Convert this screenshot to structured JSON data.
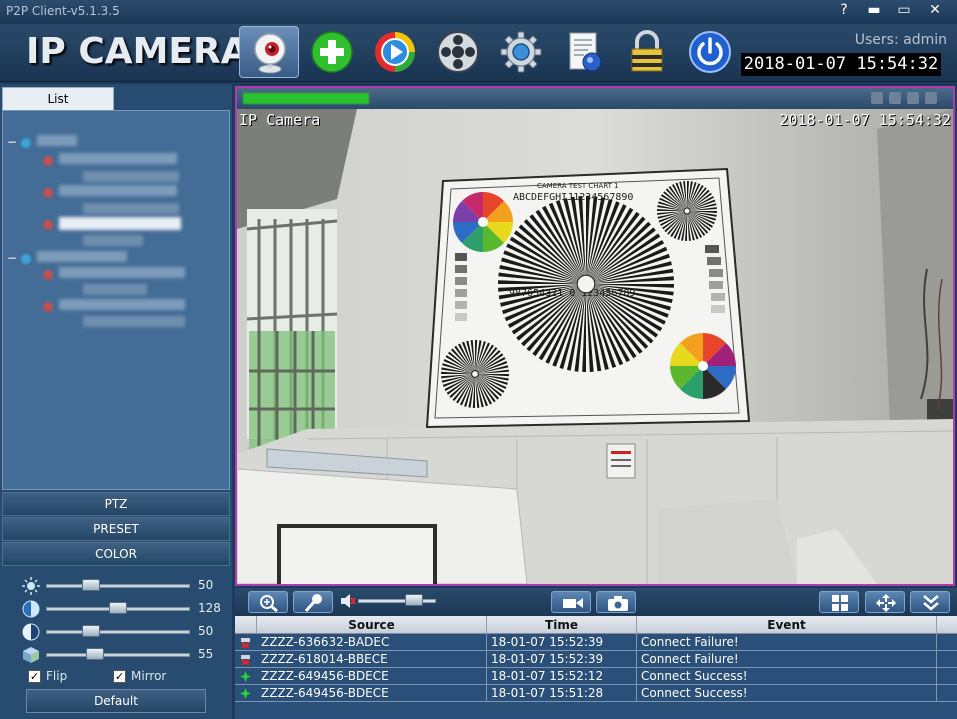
{
  "window": {
    "title": "P2P Client-v5.1.3.5",
    "help_label": "?",
    "minimize_label": "▬",
    "maximize_label": "▭",
    "close_label": "✕"
  },
  "header": {
    "brand": "IP CAMERA",
    "users_label": "Users: admin",
    "datetime": "2018-01-07 15:54:32",
    "toolbar": [
      {
        "name": "live-view",
        "icon": "webcam-icon",
        "active": true
      },
      {
        "name": "add-device",
        "icon": "plus-icon",
        "active": false
      },
      {
        "name": "playback",
        "icon": "play-icon",
        "active": false
      },
      {
        "name": "remote-playback",
        "icon": "film-reel-icon",
        "active": false
      },
      {
        "name": "settings",
        "icon": "gear-icon",
        "active": false
      },
      {
        "name": "log",
        "icon": "document-icon",
        "active": false
      },
      {
        "name": "lock",
        "icon": "padlock-icon",
        "active": false
      },
      {
        "name": "exit",
        "icon": "power-icon",
        "active": false
      }
    ]
  },
  "left": {
    "list_tab": "List",
    "sections": {
      "ptz": "PTZ",
      "preset": "PRESET",
      "color": "COLOR"
    },
    "color": {
      "brightness": 50,
      "contrast": 128,
      "saturation": 50,
      "hue": 55,
      "slider_max": 255,
      "flip_label": "Flip",
      "mirror_label": "Mirror",
      "flip_checked": true,
      "mirror_checked": true,
      "check_mark": "✓",
      "default_label": "Default"
    }
  },
  "video": {
    "osd_name": "IP Camera",
    "osd_time": "2018-01-07 15:54:32",
    "chart_title": "CAMERA TEST CHART 1",
    "chart_row_letters": "ABCDEFGHIJ1234567890",
    "chart_row_numbers": "987654321 0 123456789"
  },
  "controls": {
    "volume_level": 0.78
  },
  "log": {
    "columns": [
      "Source",
      "Time",
      "Event"
    ],
    "rows": [
      {
        "source": "ZZZZ-636632-BADEC",
        "time": "18-01-07 15:52:39",
        "event": "Connect Failure!",
        "status": "fail"
      },
      {
        "source": "ZZZZ-618014-BBECE",
        "time": "18-01-07 15:52:39",
        "event": "Connect Failure!",
        "status": "fail"
      },
      {
        "source": "ZZZZ-649456-BDECE",
        "time": "18-01-07 15:52:12",
        "event": "Connect Success!",
        "status": "ok"
      },
      {
        "source": "ZZZZ-649456-BDECE",
        "time": "18-01-07 15:51:28",
        "event": "Connect Success!",
        "status": "ok"
      }
    ]
  }
}
